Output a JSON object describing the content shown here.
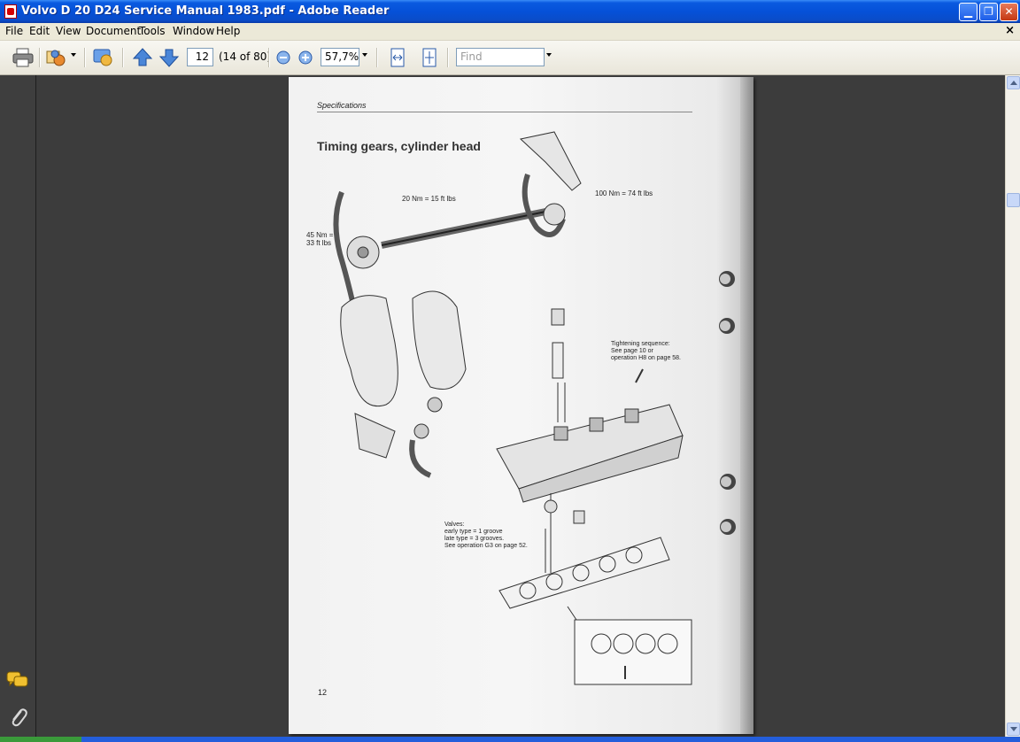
{
  "window": {
    "title": "Volvo D 20 D24 Service Manual 1983.pdf - Adobe Reader",
    "doc_close_glyph": "×"
  },
  "menu": [
    "File",
    "Edit",
    "View",
    "Document",
    "Tools",
    "Window",
    "Help"
  ],
  "toolbar": {
    "page_number": "12",
    "page_count": "(14 of 80)",
    "zoom": "57,7%",
    "find_placeholder": "Find"
  },
  "page": {
    "header": "Specifications",
    "title": "Timing gears, cylinder head",
    "labels": {
      "torque_20": "20 Nm = 15 ft lbs",
      "torque_100": "100 Nm = 74 ft lbs",
      "torque_45_a": "45 Nm =",
      "torque_45_b": "33 ft lbs",
      "tightening_1": "Tightening sequence:",
      "tightening_2": "See page 10 or",
      "tightening_3": "operation H8 on page 58.",
      "valves_1": "Valves:",
      "valves_2": "early type = 1 groove",
      "valves_3": "late type = 3 grooves.",
      "valves_4": "See operation G3 on page 52."
    },
    "page_num": "12"
  },
  "icons": {
    "print": "printer-icon",
    "organizer": "organizer-icon",
    "collab": "collaborate-icon",
    "prev": "arrow-up-icon",
    "next": "arrow-down-icon",
    "zoom_out": "zoom-out-icon",
    "zoom_in": "zoom-in-icon",
    "fit_width": "fit-width-icon",
    "fit_page": "fit-page-icon",
    "comments": "comments-icon",
    "attachments": "paperclip-icon"
  }
}
